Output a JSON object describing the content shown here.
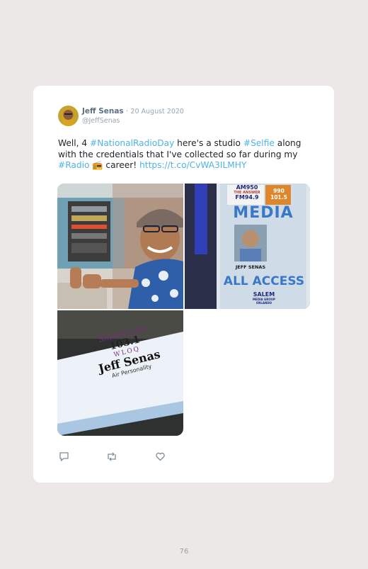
{
  "tweet": {
    "author_name": "Jeff Senas",
    "separator": "·",
    "date": "20 August 2020",
    "handle": "@JeffSenas",
    "text_parts": [
      {
        "text": "Well, 4 ",
        "link": false
      },
      {
        "text": "#NationalRadioDay",
        "link": true
      },
      {
        "text": " here's a studio ",
        "link": false
      },
      {
        "text": "#Selfie",
        "link": true
      },
      {
        "text": " along with the credentials that I've collected so far during my ",
        "link": false
      },
      {
        "text": "#Radio",
        "link": true
      },
      {
        "text": " 📻 career! ",
        "link": false
      },
      {
        "text": "https://t.co/CvWA3ILMHY",
        "link": true
      }
    ],
    "media": {
      "photo2": {
        "badge_line1": "AM950",
        "badge_line2": "THE ANSWER",
        "badge_line3": "FM94.9",
        "badge_right": "990 101.5",
        "media": "MEDIA",
        "person": "JEFF SENAS",
        "access": "ALL ACCESS",
        "salem": "SALEM",
        "salem_sub": "MEDIA GROUP",
        "city": "ORLANDO"
      },
      "photo3": {
        "brand": "Smooth Jazz",
        "freq": "103.1",
        "call": "WLOQ",
        "person": "Jeff Senas",
        "role": "Air Personality"
      }
    },
    "actions": {
      "reply_icon": "reply-icon",
      "retweet_icon": "retweet-icon",
      "like_icon": "heart-icon"
    }
  },
  "page_number": "76",
  "colors": {
    "page_bg": "#ece8e8",
    "card_bg": "#ffffff",
    "link": "#4fb3e6",
    "author": "#5d6f82",
    "meta": "#9aa6b2"
  }
}
